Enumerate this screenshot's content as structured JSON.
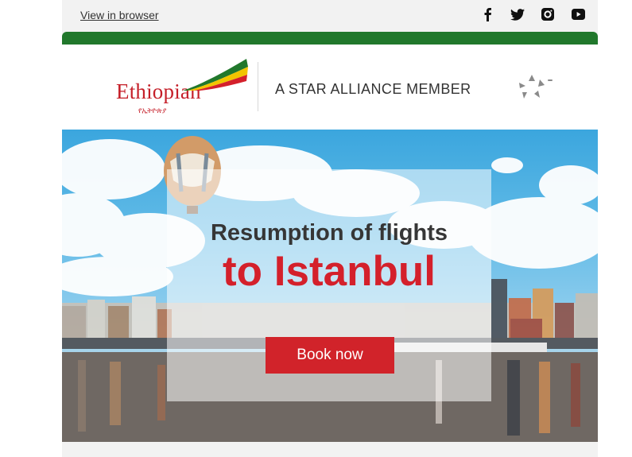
{
  "topbar": {
    "view_in_browser": "View in browser",
    "social_icons": [
      "facebook-icon",
      "twitter-icon",
      "instagram-icon",
      "youtube-icon"
    ]
  },
  "header": {
    "brand_name": "Ethiopian",
    "brand_name_amharic": "የኢትዮጵያ",
    "alliance_text": "A STAR ALLIANCE MEMBER",
    "alliance_icon": "star-alliance-logo-icon"
  },
  "hero": {
    "headline_line1": "Resumption of flights",
    "headline_line2": "to Istanbul",
    "cta_label": "Book now"
  },
  "colors": {
    "brand_green": "#21782c",
    "brand_red": "#d4202b",
    "button_red": "#d1232a",
    "headline_dark": "#363636"
  }
}
